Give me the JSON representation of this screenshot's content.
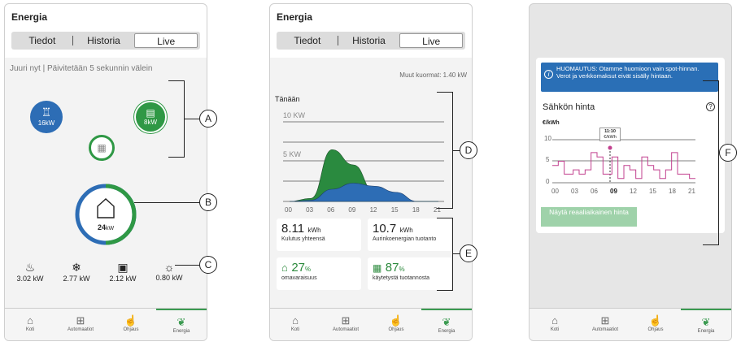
{
  "title": "Energia",
  "tabs": [
    "Tiedot",
    "Historia",
    "Live"
  ],
  "active_tab": "Live",
  "nav": [
    {
      "label": "Koti",
      "icon": "home-icon"
    },
    {
      "label": "Automaatiot",
      "icon": "grid-icon"
    },
    {
      "label": "Ohjaus",
      "icon": "hand-icon"
    },
    {
      "label": "Energia",
      "icon": "leaf-icon"
    }
  ],
  "screen1": {
    "status": "Juuri nyt | Päivitetään 5 sekunnin välein",
    "grid_value": "16kW",
    "battery_value": "8kW",
    "home_value": "24",
    "home_unit": "kW",
    "consumers": [
      {
        "icon": "appliance-icon",
        "value": "3.02 kW"
      },
      {
        "icon": "heater-icon",
        "value": "2.77 kW"
      },
      {
        "icon": "charger-icon",
        "value": "2.12 kW"
      },
      {
        "icon": "lightbulb-icon",
        "value": "0.80 kW"
      }
    ]
  },
  "screen2": {
    "other_loads": "Muut kuormat: 1.40 kW",
    "today": "Tänään",
    "y10": "10 KW",
    "y5": "5 KW",
    "x_ticks": [
      "00",
      "03",
      "06",
      "09",
      "12",
      "15",
      "18",
      "21"
    ],
    "tiles": [
      {
        "value": "8.11",
        "unit": "kWh",
        "label": "Kulutus yhteensä"
      },
      {
        "value": "10.7",
        "unit": "kWh",
        "label": "Aurinkoenergian tuotanto"
      },
      {
        "value": "27",
        "unit": "%",
        "label": "omavaraisuus"
      },
      {
        "value": "87",
        "unit": "%",
        "label": "käytetystä tuotannosta"
      }
    ]
  },
  "screen3": {
    "notice": "HUOMAUTUS: Otamme huomioon vain spot-hinnan. Verot ja verkkomaksut eivät sisälly hintaan.",
    "price_title": "Sähkön hinta",
    "unit": "€/kWh",
    "y_ticks": [
      "10",
      "5",
      "0"
    ],
    "x_ticks": [
      "00",
      "03",
      "06",
      "09",
      "12",
      "15",
      "18",
      "21"
    ],
    "tooltip_time": "11:10",
    "tooltip_unit": "€/kWh",
    "button": "Näytä reaaliaikainen hinta"
  },
  "callouts": [
    "A",
    "B",
    "C",
    "D",
    "E",
    "F"
  ],
  "chart_data": [
    {
      "type": "area",
      "x": [
        "00",
        "03",
        "06",
        "09",
        "12",
        "15",
        "18",
        "21"
      ],
      "series": [
        {
          "values": [
            0,
            0.5,
            8.5,
            6,
            1.5,
            0.5,
            0,
            0
          ]
        },
        {
          "values": [
            0,
            0.2,
            2,
            3,
            2.5,
            1.5,
            0,
            0
          ]
        }
      ],
      "ylabel": "",
      "ticks_y": [
        "5 KW",
        "10 KW"
      ]
    },
    {
      "type": "line",
      "x": [
        "00",
        "03",
        "06",
        "09",
        "12",
        "15",
        "18",
        "21"
      ],
      "series": [
        {
          "values": [
            4,
            2,
            2,
            6,
            1,
            3,
            1,
            6
          ]
        }
      ],
      "ylabel": "€/kWh",
      "ylim": [
        0,
        10
      ]
    }
  ]
}
